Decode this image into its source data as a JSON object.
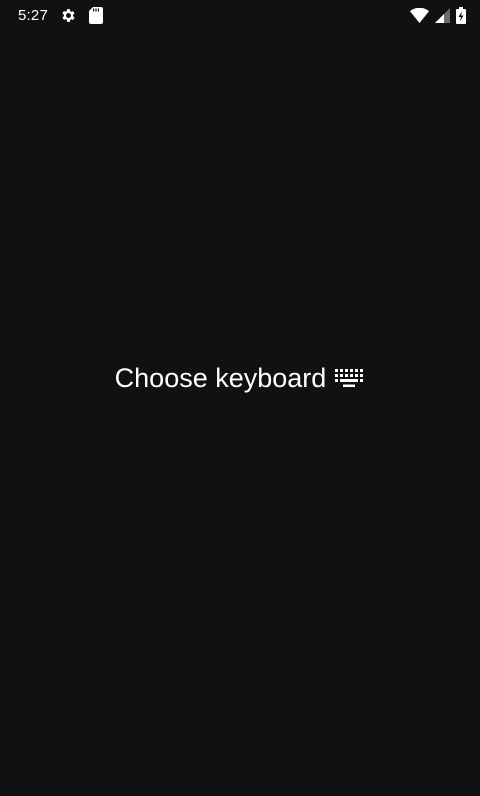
{
  "status_bar": {
    "time": "5:27",
    "icons": [
      "settings-gear-icon",
      "sd-card-icon",
      "wifi-icon",
      "cell-signal-icon",
      "battery-charging-icon"
    ]
  },
  "main": {
    "choose_keyboard_label": "Choose keyboard",
    "choose_keyboard_icon": "keyboard-icon"
  },
  "colors": {
    "background": "#111111",
    "text": "#ffffff"
  }
}
